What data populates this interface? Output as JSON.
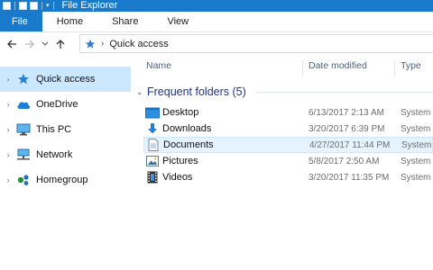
{
  "window": {
    "title": "File Explorer"
  },
  "ribbon": {
    "tabs": [
      "File",
      "Home",
      "Share",
      "View"
    ]
  },
  "address_bar": {
    "path": [
      "Quick access"
    ]
  },
  "nav_pane": {
    "items": [
      {
        "label": "Quick access",
        "icon": "star-pin-icon",
        "selected": true
      },
      {
        "label": "OneDrive",
        "icon": "cloud-icon"
      },
      {
        "label": "This PC",
        "icon": "monitor-icon"
      },
      {
        "label": "Network",
        "icon": "network-icon"
      },
      {
        "label": "Homegroup",
        "icon": "homegroup-icon"
      }
    ]
  },
  "columns": {
    "name": "Name",
    "date": "Date modified",
    "type": "Type"
  },
  "group": {
    "title": "Frequent folders (5)"
  },
  "folders": [
    {
      "name": "Desktop",
      "date": "6/13/2017 2:13 AM",
      "type": "System",
      "icon": "desktop-folder-icon"
    },
    {
      "name": "Downloads",
      "date": "3/20/2017 6:39 PM",
      "type": "System",
      "icon": "downloads-folder-icon"
    },
    {
      "name": "Documents",
      "date": "4/27/2017 11:44 PM",
      "type": "System",
      "icon": "documents-folder-icon",
      "highlighted": true
    },
    {
      "name": "Pictures",
      "date": "5/8/2017 2:50 AM",
      "type": "System",
      "icon": "pictures-folder-icon"
    },
    {
      "name": "Videos",
      "date": "3/20/2017 11:35 PM",
      "type": "System",
      "icon": "videos-folder-icon"
    }
  ],
  "colors": {
    "accent": "#1979ca",
    "selection": "#cce8ff",
    "hover": "#e5f3ff",
    "group_title": "#1e3287"
  }
}
